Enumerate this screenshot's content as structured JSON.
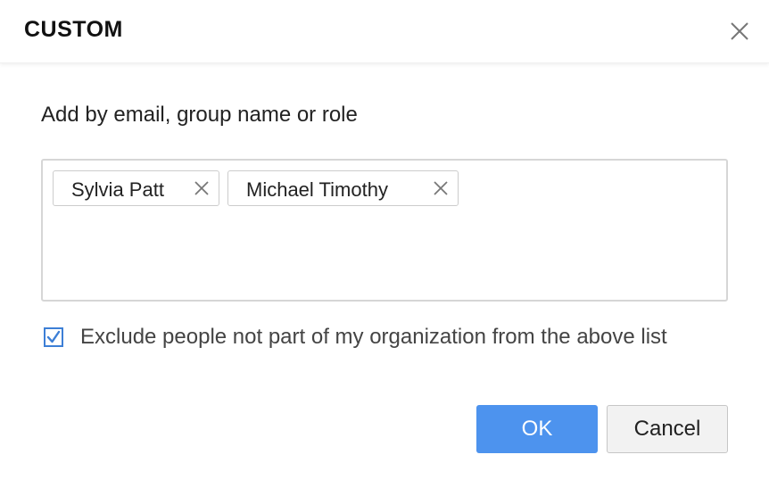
{
  "dialog": {
    "title": "CUSTOM",
    "close_icon": "close-icon"
  },
  "instruction": "Add by email, group name or role",
  "recipients": [
    {
      "name": "Sylvia Patt"
    },
    {
      "name": "Michael Timothy"
    }
  ],
  "exclude_option": {
    "label": "Exclude people not part of my organization from the above list",
    "checked": true
  },
  "buttons": {
    "ok_label": "OK",
    "cancel_label": "Cancel"
  },
  "colors": {
    "primary": "#4d93ee",
    "checkbox": "#3d7fd6"
  }
}
